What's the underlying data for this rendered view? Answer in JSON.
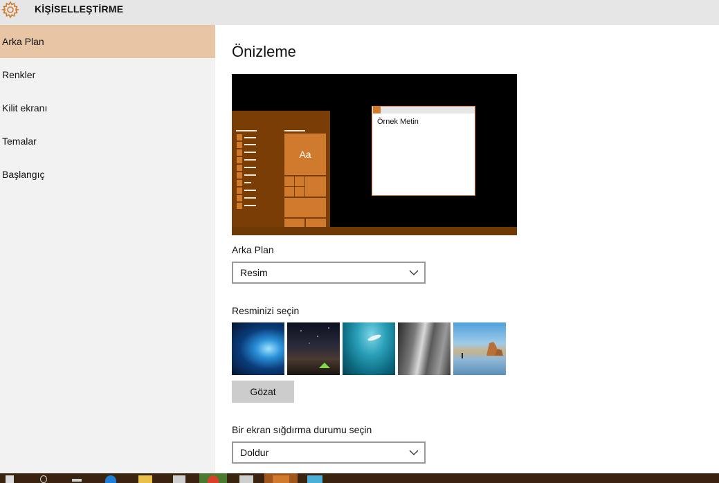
{
  "header": {
    "title": "KİŞİSELLEŞTİRME",
    "gear_icon": "gear-icon"
  },
  "sidebar": {
    "items": [
      {
        "label": "Arka Plan",
        "active": true
      },
      {
        "label": "Renkler",
        "active": false
      },
      {
        "label": "Kilit ekranı",
        "active": false
      },
      {
        "label": "Temalar",
        "active": false
      },
      {
        "label": "Başlangıç",
        "active": false
      }
    ]
  },
  "main": {
    "title": "Önizleme",
    "preview": {
      "tile_text": "Aa",
      "window_text": "Örnek Metin"
    },
    "background": {
      "label": "Arka Plan",
      "value": "Resim"
    },
    "picture": {
      "label": "Resminizi seçin",
      "thumbnails": [
        "windows-hero-wallpaper",
        "night-sky-tent-wallpaper",
        "underwater-swimmer-wallpaper",
        "rock-cliff-wallpaper",
        "beach-rocks-wallpaper"
      ],
      "browse_label": "Gözat"
    },
    "fit": {
      "label": "Bir ekran sığdırma durumu seçin",
      "value": "Doldur"
    }
  },
  "colors": {
    "accent": "#d07a2e",
    "active_nav": "#e8c6a5",
    "preview_menu": "#7a3d06"
  }
}
